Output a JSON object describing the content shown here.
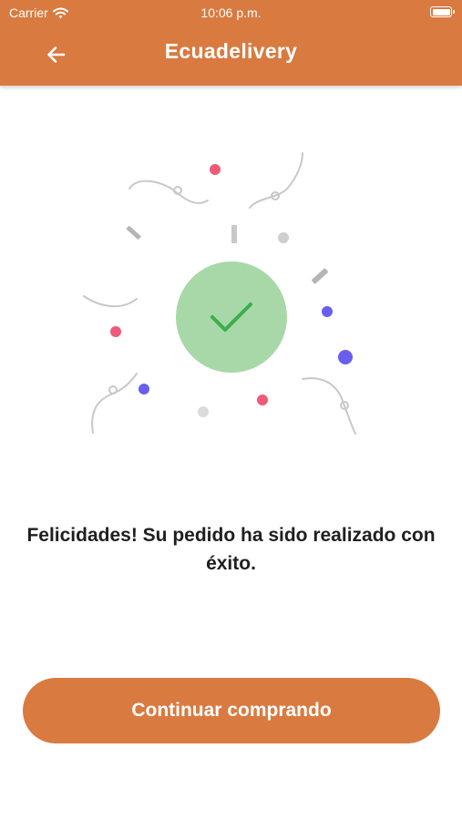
{
  "status_bar": {
    "carrier": "Carrier",
    "time": "10:06 p.m."
  },
  "header": {
    "title": "Ecuadelivery",
    "back_icon": "arrow-left-icon"
  },
  "illustration": {
    "icon": "check-icon",
    "circle_color": "#a8d8a8",
    "check_color": "#3cae4c"
  },
  "message": "Felicidades! Su pedido ha sido realizado con éxito.",
  "continue_button": {
    "label": "Continuar comprando"
  },
  "colors": {
    "primary": "#d97a40",
    "confetti_pink": "#ef5a78",
    "confetti_purple": "#6a5ef0",
    "confetti_gray": "#c8c8c8"
  }
}
